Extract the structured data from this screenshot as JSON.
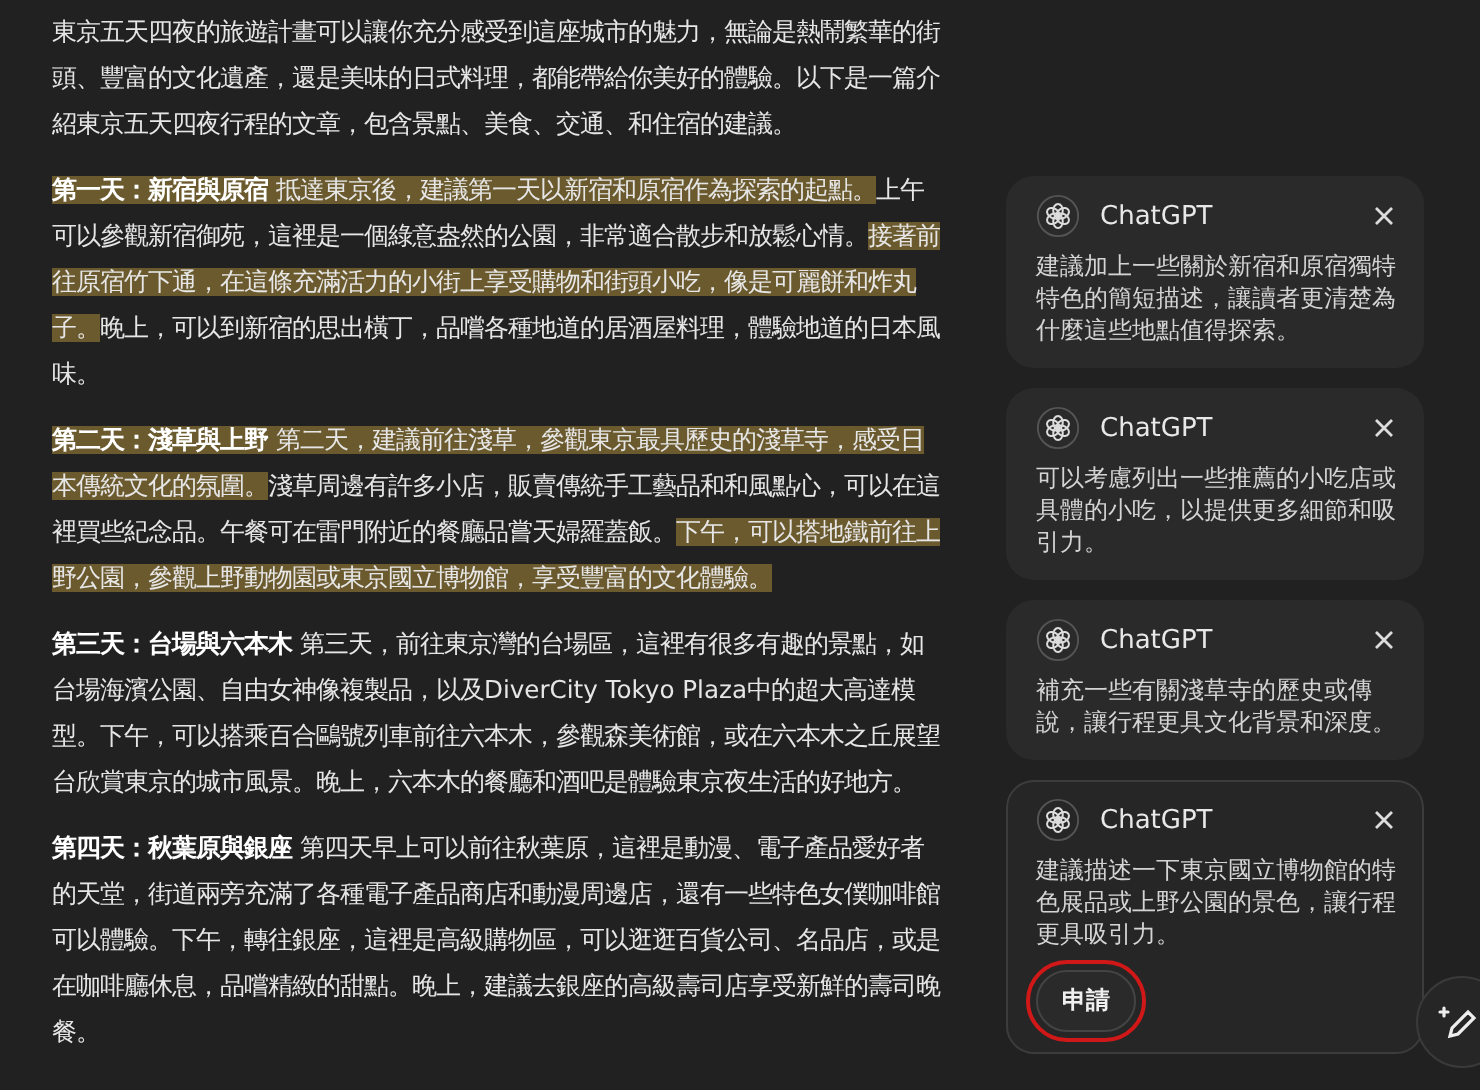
{
  "article": {
    "paragraphs": [
      {
        "segments": [
          {
            "text": "東京五天四夜的旅遊計畫可以讓你充分感受到這座城市的魅力，無論是熱鬧繁華的街頭、豐富的文化遺產，還是美味的日式料理，都能帶給你美好的體驗。以下是一篇介紹東京五天四夜行程的文章，包含景點、美食、交通、和住宿的建議。",
            "highlighted": false
          }
        ]
      },
      {
        "segments": [
          {
            "text": "**第一天：新宿與原宿** 抵達東京後，建議第一天以新宿和原宿作為探索的起點。",
            "highlighted": true
          },
          {
            "text": "上午可以參觀新宿御苑，這裡是一個綠意盎然的公園，非常適合散步和放鬆心情。",
            "highlighted": false
          },
          {
            "text": "接著前往原宿竹下通，在這條充滿活力的小街上享受購物和街頭小吃，像是可麗餅和炸丸子。",
            "highlighted": true
          },
          {
            "text": "晚上，可以到新宿的思出橫丁，品嚐各種地道的居酒屋料理，體驗地道的日本風味。",
            "highlighted": false
          }
        ]
      },
      {
        "segments": [
          {
            "text": "**第二天：淺草與上野** 第二天，建議前往淺草，參觀東京最具歷史的淺草寺，感受日本傳統文化的氛圍。",
            "highlighted": true
          },
          {
            "text": "淺草周邊有許多小店，販賣傳統手工藝品和和風點心，可以在這裡買些紀念品。午餐可在雷門附近的餐廳品嘗天婦羅蓋飯。",
            "highlighted": false
          },
          {
            "text": "下午，可以搭地鐵前往上野公園，參觀上野動物園或東京國立博物館，享受豐富的文化體驗。",
            "highlighted": true
          }
        ]
      },
      {
        "segments": [
          {
            "text": "**第三天：台場與六本木** 第三天，前往東京灣的台場區，這裡有很多有趣的景點，如台場海濱公園、自由女神像複製品，以及DiverCity Tokyo Plaza中的超大高達模型。下午，可以搭乘百合鷗號列車前往六本木，參觀森美術館，或在六本木之丘展望台欣賞東京的城市風景。晚上，六本木的餐廳和酒吧是體驗東京夜生活的好地方。",
            "highlighted": false
          }
        ]
      },
      {
        "segments": [
          {
            "text": "**第四天：秋葉原與銀座** 第四天早上可以前往秋葉原，這裡是動漫、電子產品愛好者的天堂，街道兩旁充滿了各種電子產品商店和動漫周邊店，還有一些特色女僕咖啡館可以體驗。下午，轉往銀座，這裡是高級購物區，可以逛逛百貨公司、名品店，或是在咖啡廳休息，品嚐精緻的甜點。晚上，建議去銀座的高級壽司店享受新鮮的壽司晚餐。",
            "highlighted": false
          }
        ]
      }
    ]
  },
  "comments": [
    {
      "author": "ChatGPT",
      "text": "建議加上一些關於新宿和原宿獨特特色的簡短描述，讓讀者更清楚為什麼這些地點值得探索。",
      "selected": false
    },
    {
      "author": "ChatGPT",
      "text": "可以考慮列出一些推薦的小吃店或具體的小吃，以提供更多細節和吸引力。",
      "selected": false
    },
    {
      "author": "ChatGPT",
      "text": "補充一些有關淺草寺的歷史或傳說，讓行程更具文化背景和深度。",
      "selected": false
    },
    {
      "author": "ChatGPT",
      "text": "建議描述一下東京國立博物館的特色展品或上野公園的景色，讓行程更具吸引力。",
      "selected": true,
      "apply_button": {
        "label": "申請",
        "outlined": true
      }
    }
  ]
}
